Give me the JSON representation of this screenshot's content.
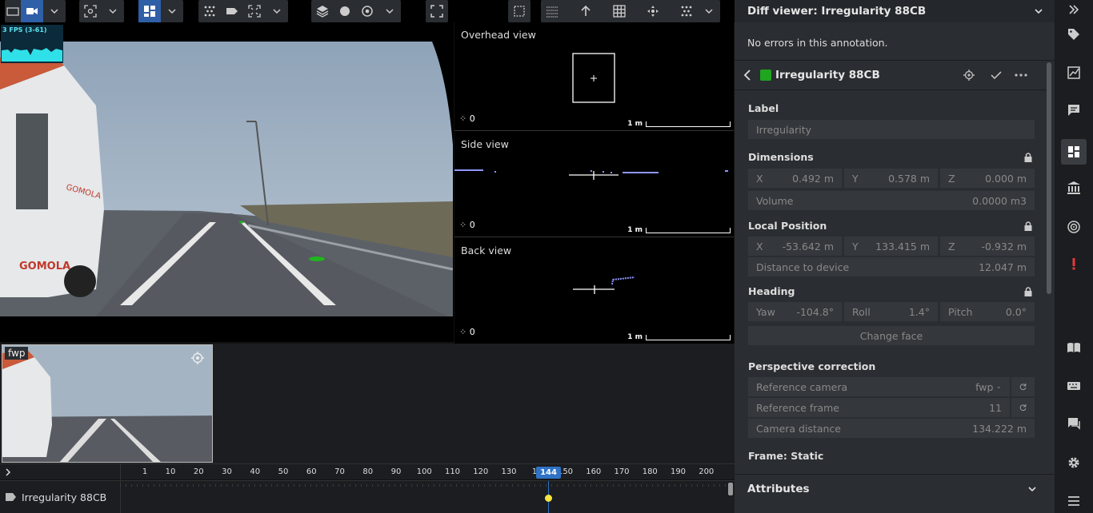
{
  "camera": {
    "fps_label": "3 FPS (3-61)"
  },
  "views": [
    {
      "title": "Overhead view",
      "count": "0",
      "scale": "1 m"
    },
    {
      "title": "Side view",
      "count": "0",
      "scale": "1 m"
    },
    {
      "title": "Back view",
      "count": "0",
      "scale": "1 m"
    }
  ],
  "thumbnail": {
    "label": "fwp"
  },
  "timeline": {
    "ticks": [
      "1",
      "10",
      "20",
      "30",
      "40",
      "50",
      "60",
      "70",
      "80",
      "90",
      "100",
      "110",
      "120",
      "130",
      "14",
      "150",
      "160",
      "170",
      "180",
      "190",
      "200"
    ],
    "current_frame": "144",
    "track_label": "Irregularity 88CB"
  },
  "panel": {
    "header_title": "Diff viewer: Irregularity 88CB",
    "no_errors": "No errors in this annotation.",
    "annotation_title": "Irregularity 88CB",
    "annotation_color": "#1fa51f",
    "label_section": "Label",
    "label_value": "Irregularity",
    "dimensions_section": "Dimensions",
    "dim": {
      "x_key": "X",
      "x": "0.492 m",
      "y_key": "Y",
      "y": "0.578 m",
      "z_key": "Z",
      "z": "0.000 m"
    },
    "volume_key": "Volume",
    "volume": "0.0000 m3",
    "local_section": "Local Position",
    "pos": {
      "x_key": "X",
      "x": "-53.642 m",
      "y_key": "Y",
      "y": "133.415 m",
      "z_key": "Z",
      "z": "-0.932 m"
    },
    "distance_key": "Distance to device",
    "distance": "12.047 m",
    "heading_section": "Heading",
    "head": {
      "yaw_key": "Yaw",
      "yaw": "-104.8°",
      "roll_key": "Roll",
      "roll": "1.4°",
      "pitch_key": "Pitch",
      "pitch": "0.0°"
    },
    "change_face": "Change face",
    "persp_section": "Perspective correction",
    "ref_camera_key": "Reference camera",
    "ref_camera": "fwp",
    "ref_frame_key": "Reference frame",
    "ref_frame": "11",
    "cam_dist_key": "Camera distance",
    "cam_dist": "134.222 m",
    "frame_label": "Frame: Static",
    "attributes": "Attributes"
  },
  "colors": {
    "accent": "#2f5fa6",
    "panel_bg": "#2a2d31",
    "error": "#e53935"
  }
}
